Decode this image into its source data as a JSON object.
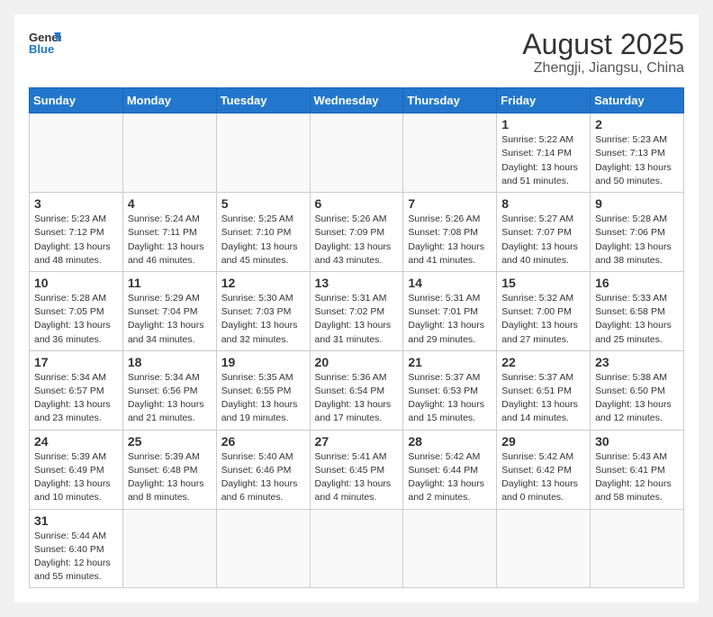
{
  "logo": {
    "text_general": "General",
    "text_blue": "Blue"
  },
  "header": {
    "month": "August 2025",
    "location": "Zhengji, Jiangsu, China"
  },
  "weekdays": [
    "Sunday",
    "Monday",
    "Tuesday",
    "Wednesday",
    "Thursday",
    "Friday",
    "Saturday"
  ],
  "weeks": [
    [
      {
        "day": "",
        "info": ""
      },
      {
        "day": "",
        "info": ""
      },
      {
        "day": "",
        "info": ""
      },
      {
        "day": "",
        "info": ""
      },
      {
        "day": "",
        "info": ""
      },
      {
        "day": "1",
        "info": "Sunrise: 5:22 AM\nSunset: 7:14 PM\nDaylight: 13 hours and 51 minutes."
      },
      {
        "day": "2",
        "info": "Sunrise: 5:23 AM\nSunset: 7:13 PM\nDaylight: 13 hours and 50 minutes."
      }
    ],
    [
      {
        "day": "3",
        "info": "Sunrise: 5:23 AM\nSunset: 7:12 PM\nDaylight: 13 hours and 48 minutes."
      },
      {
        "day": "4",
        "info": "Sunrise: 5:24 AM\nSunset: 7:11 PM\nDaylight: 13 hours and 46 minutes."
      },
      {
        "day": "5",
        "info": "Sunrise: 5:25 AM\nSunset: 7:10 PM\nDaylight: 13 hours and 45 minutes."
      },
      {
        "day": "6",
        "info": "Sunrise: 5:26 AM\nSunset: 7:09 PM\nDaylight: 13 hours and 43 minutes."
      },
      {
        "day": "7",
        "info": "Sunrise: 5:26 AM\nSunset: 7:08 PM\nDaylight: 13 hours and 41 minutes."
      },
      {
        "day": "8",
        "info": "Sunrise: 5:27 AM\nSunset: 7:07 PM\nDaylight: 13 hours and 40 minutes."
      },
      {
        "day": "9",
        "info": "Sunrise: 5:28 AM\nSunset: 7:06 PM\nDaylight: 13 hours and 38 minutes."
      }
    ],
    [
      {
        "day": "10",
        "info": "Sunrise: 5:28 AM\nSunset: 7:05 PM\nDaylight: 13 hours and 36 minutes."
      },
      {
        "day": "11",
        "info": "Sunrise: 5:29 AM\nSunset: 7:04 PM\nDaylight: 13 hours and 34 minutes."
      },
      {
        "day": "12",
        "info": "Sunrise: 5:30 AM\nSunset: 7:03 PM\nDaylight: 13 hours and 32 minutes."
      },
      {
        "day": "13",
        "info": "Sunrise: 5:31 AM\nSunset: 7:02 PM\nDaylight: 13 hours and 31 minutes."
      },
      {
        "day": "14",
        "info": "Sunrise: 5:31 AM\nSunset: 7:01 PM\nDaylight: 13 hours and 29 minutes."
      },
      {
        "day": "15",
        "info": "Sunrise: 5:32 AM\nSunset: 7:00 PM\nDaylight: 13 hours and 27 minutes."
      },
      {
        "day": "16",
        "info": "Sunrise: 5:33 AM\nSunset: 6:58 PM\nDaylight: 13 hours and 25 minutes."
      }
    ],
    [
      {
        "day": "17",
        "info": "Sunrise: 5:34 AM\nSunset: 6:57 PM\nDaylight: 13 hours and 23 minutes."
      },
      {
        "day": "18",
        "info": "Sunrise: 5:34 AM\nSunset: 6:56 PM\nDaylight: 13 hours and 21 minutes."
      },
      {
        "day": "19",
        "info": "Sunrise: 5:35 AM\nSunset: 6:55 PM\nDaylight: 13 hours and 19 minutes."
      },
      {
        "day": "20",
        "info": "Sunrise: 5:36 AM\nSunset: 6:54 PM\nDaylight: 13 hours and 17 minutes."
      },
      {
        "day": "21",
        "info": "Sunrise: 5:37 AM\nSunset: 6:53 PM\nDaylight: 13 hours and 15 minutes."
      },
      {
        "day": "22",
        "info": "Sunrise: 5:37 AM\nSunset: 6:51 PM\nDaylight: 13 hours and 14 minutes."
      },
      {
        "day": "23",
        "info": "Sunrise: 5:38 AM\nSunset: 6:50 PM\nDaylight: 13 hours and 12 minutes."
      }
    ],
    [
      {
        "day": "24",
        "info": "Sunrise: 5:39 AM\nSunset: 6:49 PM\nDaylight: 13 hours and 10 minutes."
      },
      {
        "day": "25",
        "info": "Sunrise: 5:39 AM\nSunset: 6:48 PM\nDaylight: 13 hours and 8 minutes."
      },
      {
        "day": "26",
        "info": "Sunrise: 5:40 AM\nSunset: 6:46 PM\nDaylight: 13 hours and 6 minutes."
      },
      {
        "day": "27",
        "info": "Sunrise: 5:41 AM\nSunset: 6:45 PM\nDaylight: 13 hours and 4 minutes."
      },
      {
        "day": "28",
        "info": "Sunrise: 5:42 AM\nSunset: 6:44 PM\nDaylight: 13 hours and 2 minutes."
      },
      {
        "day": "29",
        "info": "Sunrise: 5:42 AM\nSunset: 6:42 PM\nDaylight: 13 hours and 0 minutes."
      },
      {
        "day": "30",
        "info": "Sunrise: 5:43 AM\nSunset: 6:41 PM\nDaylight: 12 hours and 58 minutes."
      }
    ],
    [
      {
        "day": "31",
        "info": "Sunrise: 5:44 AM\nSunset: 6:40 PM\nDaylight: 12 hours and 55 minutes."
      },
      {
        "day": "",
        "info": ""
      },
      {
        "day": "",
        "info": ""
      },
      {
        "day": "",
        "info": ""
      },
      {
        "day": "",
        "info": ""
      },
      {
        "day": "",
        "info": ""
      },
      {
        "day": "",
        "info": ""
      }
    ]
  ]
}
